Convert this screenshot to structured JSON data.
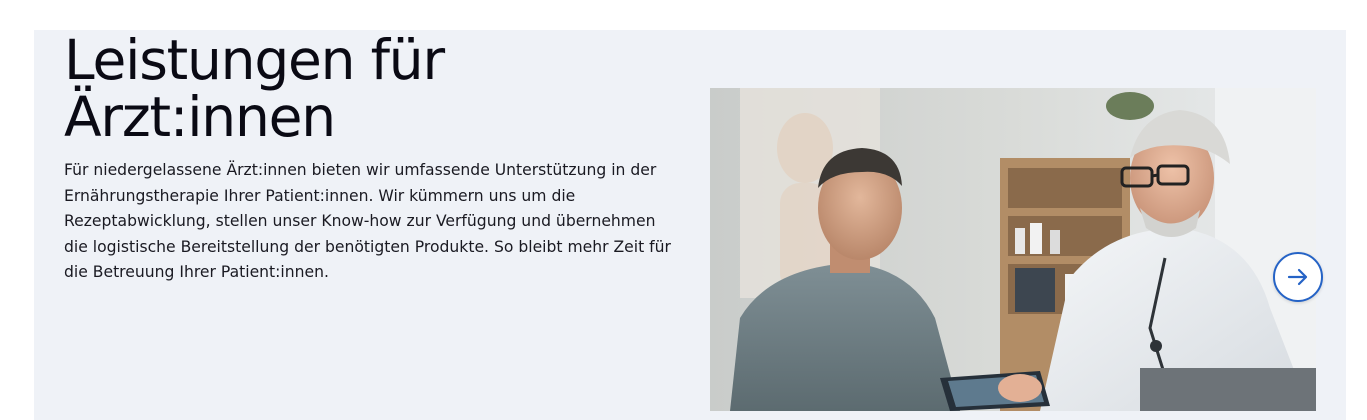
{
  "section": {
    "heading_line1": "Leistungen für",
    "heading_line2": "Ärzt:innen",
    "intro": "Für niedergelassene Ärzt:innen bieten wir umfassende Unterstützung in der Ernährungstherapie Ihrer Patient:innen. Wir kümmern uns um die Rezeptabwicklung, stellen unser Know-how zur Verfügung und übernehmen die logistische Bereitstellung der benötigten Produkte. So bleibt mehr Zeit für die Betreuung Ihrer Patient:innen."
  },
  "carousel": {
    "next_icon": "arrow-right-icon",
    "accent_color": "#2563c6"
  },
  "colors": {
    "section_bg": "#eff2f7",
    "text": "#0a0a14"
  }
}
